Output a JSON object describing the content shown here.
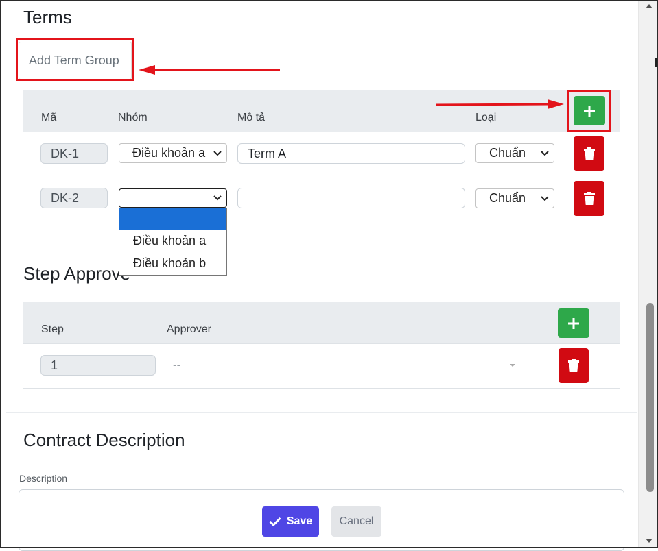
{
  "terms": {
    "title": "Terms",
    "add_group_label": "Add Term Group",
    "headers": {
      "code": "Mã",
      "group": "Nhóm",
      "description": "Mô tả",
      "type": "Loại"
    },
    "rows": [
      {
        "code": "DK-1",
        "group": "Điều khoản a",
        "description": "Term A",
        "type": "Chuẩn"
      },
      {
        "code": "DK-2",
        "group": "",
        "description": "",
        "type": "Chuẩn"
      }
    ],
    "group_options": [
      "",
      "Điều khoản a",
      "Điều khoản b"
    ]
  },
  "step_approve": {
    "title": "Step Approve",
    "headers": {
      "step": "Step",
      "approver": "Approver"
    },
    "rows": [
      {
        "step": "1",
        "approver": "--"
      }
    ]
  },
  "contract_description": {
    "title": "Contract Description",
    "description_label": "Description"
  },
  "footer": {
    "save_label": "Save",
    "cancel_label": "Cancel"
  },
  "colors": {
    "annotation_red": "#e3141b",
    "add_green": "#2ea84a",
    "delete_red": "#d10a12",
    "primary_indigo": "#4f46e5",
    "dropdown_highlight": "#1a6fd6"
  },
  "icons": [
    "plus-icon",
    "trash-icon",
    "chevron-down-icon",
    "check-icon",
    "caret-down-icon"
  ]
}
